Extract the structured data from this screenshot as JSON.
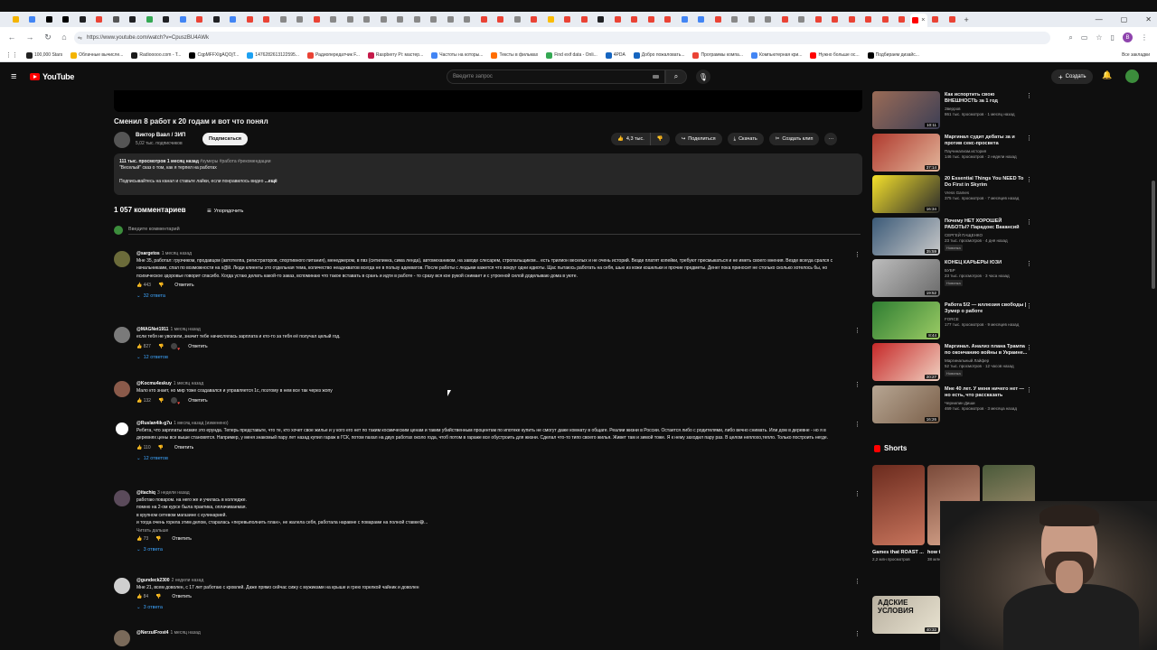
{
  "browser": {
    "url": "https://www.youtube.com/watch?v=CpuszBU4AWk",
    "tab_colors": [
      "#f4b400",
      "#4285f4",
      "#000000",
      "#000000",
      "#202124",
      "#ea4335",
      "#555555",
      "#202124",
      "#34a853",
      "#202124",
      "#4285f4",
      "#ea4335",
      "#202124",
      "#4285f4",
      "#ea4335",
      "#ea4335",
      "#888888",
      "#888888",
      "#ea4335",
      "#888888",
      "#888888",
      "#888888",
      "#888888",
      "#888888",
      "#888888",
      "#888888",
      "#888888",
      "#888888",
      "#ea4335",
      "#ea4335",
      "#888888",
      "#ea4335",
      "#fbbc04",
      "#ea4335",
      "#ea4335",
      "#202124",
      "#ea4335",
      "#ea4335",
      "#ea4335",
      "#ea4335",
      "#4285f4",
      "#4285f4",
      "#ea4335",
      "#888888",
      "#888888",
      "#888888",
      "#ea4335",
      "#888888",
      "#ea4335",
      "#ea4335",
      "#ea4335",
      "#ea4335",
      "#ea4335",
      "#ea4335",
      "#ea4335",
      "#ea4335"
    ],
    "profile_letter": "B",
    "bookmarks": [
      {
        "label": "100,000 Stars",
        "color": "#222222"
      },
      {
        "label": "Облачные вычисле...",
        "color": "#f4b400"
      },
      {
        "label": "Radiooooo.com - T...",
        "color": "#1a1a1a"
      },
      {
        "label": "CqpMFFXIgAQOjT...",
        "color": "#000000"
      },
      {
        "label": "1476282613122595...",
        "color": "#1da1f2"
      },
      {
        "label": "Радиопередатчик F...",
        "color": "#ea4335"
      },
      {
        "label": "Raspberry Pi: мастер...",
        "color": "#c51a4a"
      },
      {
        "label": "Частоты на которы...",
        "color": "#4285f4"
      },
      {
        "label": "Тексты в фильмах",
        "color": "#ff6d00"
      },
      {
        "label": "Find exif data - Onli...",
        "color": "#34a853"
      },
      {
        "label": "4PDA",
        "color": "#1565c0"
      },
      {
        "label": "Добро пожаловать...",
        "color": "#1565c0"
      },
      {
        "label": "Программы компа...",
        "color": "#ea4335"
      },
      {
        "label": "Компьютерная кри...",
        "color": "#4285f4"
      },
      {
        "label": "Нужно больше ос...",
        "color": "#ff0000"
      },
      {
        "label": "Подбираем дизайс...",
        "color": "#000000"
      }
    ],
    "bookmarks_all": "Все закладки"
  },
  "masthead": {
    "logo_text": "YouTube",
    "search_placeholder": "Введите запрос",
    "create_label": "Создать"
  },
  "video": {
    "title": "Сменил 8 работ к 20 годам и вот что понял",
    "channel": "Виктор Вавл / ЗИП",
    "subscribers": "5,02 тыс. подписчиков",
    "subscribe_label": "Подписаться",
    "likes": "4,3 тыс.",
    "share_label": "Поделиться",
    "download_label": "Скачать",
    "clip_label": "Создать клип",
    "description": {
      "views_date": "111 тыс. просмотров  1 месяц назад",
      "hashtags": "#зумеры #работа #рекомендации",
      "line1": "\"Веселый\" сказ о том, как я терпел на работах",
      "line2": "Подписывайтесь на канал и ставьте лайки, если понравилось видео",
      "more": "...ещё"
    }
  },
  "comments_section": {
    "count_label": "1 057 комментариев",
    "sort_label": "Упорядочить",
    "add_placeholder": "Введите комментарий",
    "reply_label": "Ответить",
    "comments": [
      {
        "author": "@sargetos",
        "time": "1 месяц назад",
        "text": "Мне 35, работал: грузчиком, продавцом (автотелпа, регистраторов, спортивного питания), менеджером, в пвз (ситилинка, сима ленда), автомехаником, на заводе слесарем, стропальщиком... есть трилион веселых и не очень историй. Везде платят копейки, требуют пресмыкаться и не иметь своего мнения. Везде всегда срался с начальниками, спал по возможности на х@й. Люди клиенты это отдельная тема, количество неадекватов всегда не в пользу адекватов. После работы с людьми кажется что вокруг одни идиоты. Щас пытаюсь работать на себя, шью из кожи кошельки и прочие предметы. Денег пока приносит не столько сколько хотелось бы, но психическое здоровье говорит спасибо. Когда устаю делать какой-то заказ, вспоминаю что такое вставать в сранъ и идти в работе - то сразу вся кое рукой снимает и с утроеной силой доделываю дома в уюте.",
        "likes": "443",
        "replies": "32 ответа",
        "heart": false
      },
      {
        "author": "@MAGNet1911",
        "time": "1 месяц назад",
        "text": "если тебя не уволили, значит тебе начислялась зарплата и кто-то за тебя её получал целый год.",
        "likes": "827",
        "replies": "12 ответов",
        "heart": true
      },
      {
        "author": "@Kocmu4eskuy",
        "time": "1 месяц назад",
        "text": "Мало кто знает, но мир тоже создавался и управляется 1с, поэтому в нем все так через жопу",
        "likes": "132",
        "replies": "",
        "heart": true
      },
      {
        "author": "@Ruslan4ik-g7u",
        "time": "1 месяц назад (изменено)",
        "text": "Ребята, что зарплаты низкие это ерунда. Теперь представьте, что те, кто хочет свое жилье и у кого его нет по таким космическим ценам  и таким убийственным процентам по ипотеке купить не смогут даже комнату в общаге. Реалии жизни в России. Остается либо с родителями, либо вечно снимать. Или дом в деревне - но я в деревнях цены все выше становятся. Например, у меня знакомый пару лет назад купил гараж в ГСК, потом пахал на двух работах около года, чтоб потом в гараже все обустроить для жизни. Сделал что-то типо своего жилья. Живет там и зимой тоже. Я к нему заходил пару раз. В целом неплохо,тепло. Только построить негде.",
        "likes": "110",
        "replies": "12 ответов",
        "heart": false
      },
      {
        "author": "@itachiq",
        "time": "3 недели назад",
        "text": "работаю поваром. на него же и училась в колледже.\nпомню на 2-ом курсе была практика, оплачиваемая.\nв крупном сетевом магазине с кулинарией.\nи тогда очень горела этим делом, старалась «перевыполнить план», не жалела себя, работала наравне с поварами на полной ставке😅...",
        "readmore": "Читать дальше",
        "likes": "73",
        "replies": "3 ответа",
        "heart": false
      },
      {
        "author": "@gundeck2300",
        "time": "2 недели назад",
        "text": "Мне 21, всем доволен, с 17 лет работаю с кровлей. Даже прямо сейчас сижу с мужиками на крыше и грею горелкой чайник и доволен",
        "likes": "84",
        "replies": "3 ответа",
        "heart": false
      },
      {
        "author": "@NerzulFrost4",
        "time": "1 месяц назад",
        "text": "",
        "likes": "",
        "replies": "",
        "heart": false
      }
    ]
  },
  "sidebar": {
    "videos": [
      {
        "title": "Как испортить свою ВНЕШНОСТЬ за 1 год",
        "channel": "Зверров",
        "stats": "861 тыс. просмотров · 1 месяц назад",
        "duration": "10:11",
        "badge": "",
        "colors": [
          "#9a6b56",
          "#3d3f55"
        ]
      },
      {
        "title": "Маргинал судит дебаты за и против секс-просвета",
        "channel": "Паучинализм.история",
        "stats": "146 тыс. просмотров · 2 недели назад",
        "duration": "37:14",
        "badge": "",
        "colors": [
          "#b03a2e",
          "#e2b59a"
        ]
      },
      {
        "title": "20 Essential Things You NEED To Do First in Skyrim",
        "channel": "Vress Games",
        "stats": "375 тыс. просмотров · 7 месяцев назад",
        "duration": "16:34",
        "badge": "",
        "colors": [
          "#f5e12b",
          "#2b2b2b"
        ]
      },
      {
        "title": "Почему НЕТ ХОРОШЕЙ РАБОТЫ? Парадокс Вакансий",
        "channel": "СЕРГЕЙ ПАЩЕНКО",
        "stats": "23 тыс. просмотров · 4 дня назад",
        "duration": "35:59",
        "badge": "Новинка",
        "colors": [
          "#3b5a78",
          "#c9c9c9"
        ]
      },
      {
        "title": "КОНЕЦ КАРЬЕРЫ ЮЗИ",
        "channel": "БУБР",
        "stats": "23 тыс. просмотров · 3 часа назад",
        "duration": "19:52",
        "badge": "Новинка",
        "colors": [
          "#bdbdbd",
          "#6b6b6b"
        ]
      },
      {
        "title": "Работа 5/2 — иллюзия свободы | Зумер о работе",
        "channel": "FORCE",
        "stats": "177 тыс. просмотров · 9 месяцев назад",
        "duration": "8:44",
        "badge": "",
        "colors": [
          "#2e7d32",
          "#9ccc65"
        ]
      },
      {
        "title": "Маргинал. Анализ плана Трампа по окончанию войны в Украине...",
        "channel": "Маргинальный Лайфер",
        "stats": "52 тыс. просмотров · 12 часов назад",
        "duration": "20:27",
        "badge": "Новинка",
        "colors": [
          "#c62828",
          "#f0d0c0"
        ]
      },
      {
        "title": "Мне 40 лет. У меня ничего нет — но есть, что рассказать",
        "channel": "Чернилин Диши",
        "stats": "469 тыс. просмотров · 3 месяца назад",
        "duration": "16:26",
        "badge": "",
        "colors": [
          "#b7a693",
          "#7a5f49"
        ]
      }
    ],
    "shorts_title": "Shorts",
    "shorts": [
      {
        "title": "Games that ROAST ...",
        "views": "2,2 млн просмотров",
        "colors": [
          "#6b2b1e",
          "#c7745c"
        ]
      },
      {
        "title": "how to fix a crazy ...",
        "views": "38 млн просмотров",
        "colors": [
          "#7a4a3a",
          "#d8a58c"
        ]
      },
      {
        "title": "",
        "views": "",
        "colors": [
          "#4a5a3a",
          "#c0a080"
        ]
      }
    ],
    "bottom_thumb_text": "АДСКИЕ УСЛОВИЯ",
    "bottom_thumb_duration": "40:32"
  }
}
